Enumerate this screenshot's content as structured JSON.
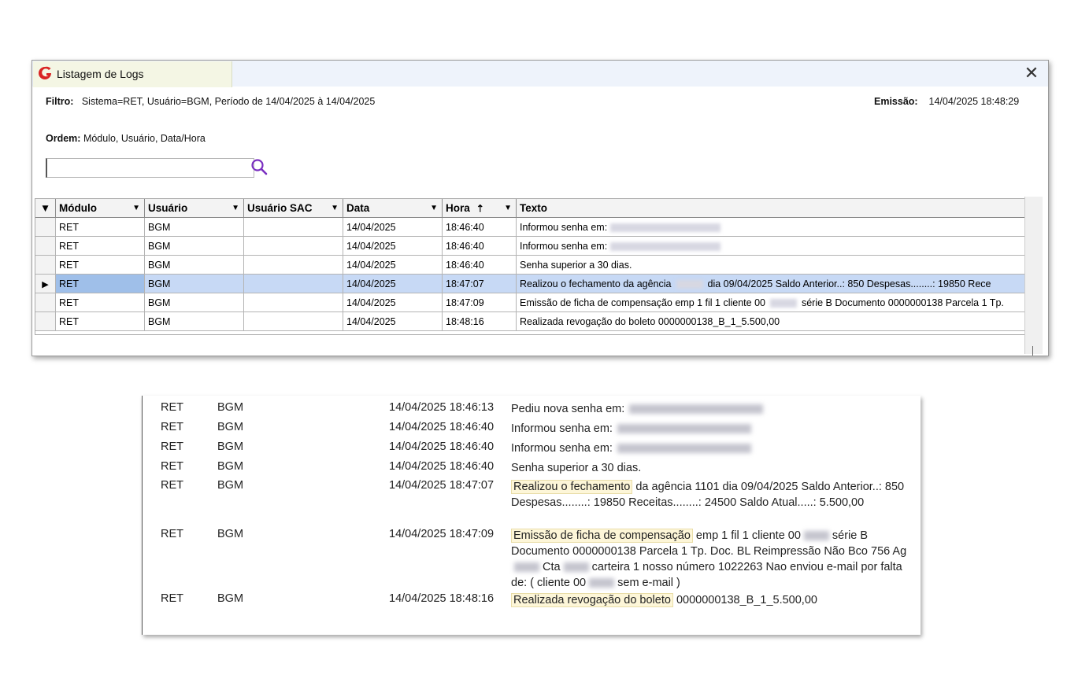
{
  "window": {
    "title": "Listagem de Logs",
    "close_glyph": "✕",
    "icon": "app-logo-icon",
    "brand_color": "#d92424"
  },
  "header": {
    "filter_label": "Filtro:",
    "filter_value": "Sistema=RET, Usuário=BGM, Período de 14/04/2025 à 14/04/2025",
    "emission_label": "Emissão:",
    "emission_value": "14/04/2025 18:48:29",
    "order_label": "Ordem:",
    "order_value": "Módulo, Usuário, Data/Hora",
    "search_value": ""
  },
  "grid": {
    "columns": [
      "Módulo",
      "Usuário",
      "Usuário SAC",
      "Data",
      "Hora",
      "Texto"
    ],
    "selected_row": 3,
    "rows": [
      {
        "modulo": "RET",
        "usuario": "BGM",
        "sac": "",
        "data": "14/04/2025",
        "hora": "18:46:40",
        "texto": "Informou senha em:"
      },
      {
        "modulo": "RET",
        "usuario": "BGM",
        "sac": "",
        "data": "14/04/2025",
        "hora": "18:46:40",
        "texto": "Informou senha em:"
      },
      {
        "modulo": "RET",
        "usuario": "BGM",
        "sac": "",
        "data": "14/04/2025",
        "hora": "18:46:40",
        "texto": "Senha superior a 30 dias."
      },
      {
        "modulo": "RET",
        "usuario": "BGM",
        "sac": "",
        "data": "14/04/2025",
        "hora": "18:47:07",
        "texto_a": "Realizou o fechamento da agência",
        "texto_b": "dia 09/04/2025 Saldo Anterior..: 850 Despesas........: 19850 Rece"
      },
      {
        "modulo": "RET",
        "usuario": "BGM",
        "sac": "",
        "data": "14/04/2025",
        "hora": "18:47:09",
        "texto_a": "Emissão de ficha de compensação  emp 1 fil 1 cliente 00",
        "texto_b": "série B Documento 0000000138 Parcela 1 Tp."
      },
      {
        "modulo": "RET",
        "usuario": "BGM",
        "sac": "",
        "data": "14/04/2025",
        "hora": "18:48:16",
        "texto": "Realizada revogação do boleto 0000000138_B_1_5.500,00"
      }
    ]
  },
  "report": {
    "rows": [
      {
        "modulo": "RET",
        "usuario": "BGM",
        "datahora": "14/04/2025 18:46:13",
        "texto": "Pediu nova senha em:"
      },
      {
        "modulo": "RET",
        "usuario": "BGM",
        "datahora": "14/04/2025 18:46:40",
        "texto": "Informou senha em:"
      },
      {
        "modulo": "RET",
        "usuario": "BGM",
        "datahora": "14/04/2025 18:46:40",
        "texto": "Informou senha em:"
      },
      {
        "modulo": "RET",
        "usuario": "BGM",
        "datahora": "14/04/2025 18:46:40",
        "texto": "Senha superior a 30 dias."
      },
      {
        "modulo": "RET",
        "usuario": "BGM",
        "datahora": "14/04/2025 18:47:07",
        "hl": "Realizou o fechamento",
        "texto": "da agência 1101 dia 09/04/2025 Saldo Anterior..: 850 Despesas........: 19850 Receitas........: 24500 Saldo Atual.....: 5.500,00"
      },
      {
        "modulo": "RET",
        "usuario": "BGM",
        "datahora": "14/04/2025 18:47:09",
        "hl": "Emissão de ficha de compensação",
        "texto_a": "emp 1 fil 1 cliente 00",
        "texto_b": "série B Documento 0000000138 Parcela 1 Tp. Doc. BL Reimpressão Não Bco 756 Ag",
        "texto_c": "Cta",
        "texto_d": "carteira 1 nosso número 1022263 Nao enviou e-mail por falta de:  ( cliente 00",
        "texto_e": "sem e-mail )"
      },
      {
        "modulo": "RET",
        "usuario": "BGM",
        "datahora": "14/04/2025 18:48:16",
        "hl": "Realizada revogação do boleto",
        "texto": "0000000138_B_1_5.500,00"
      }
    ]
  }
}
